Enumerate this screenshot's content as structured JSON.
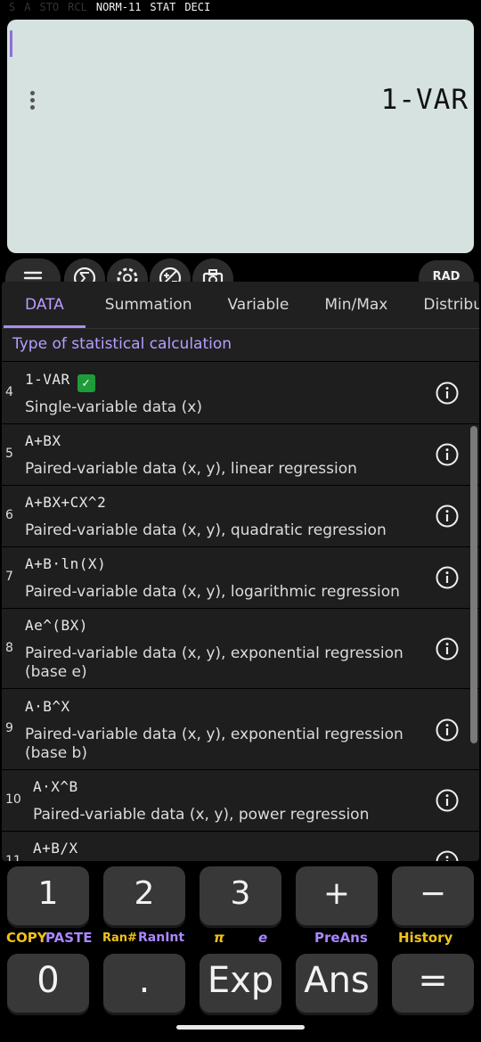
{
  "status_bar": {
    "indicators": [
      {
        "label": "S",
        "active": false
      },
      {
        "label": "A",
        "active": false
      },
      {
        "label": "STO",
        "active": false
      },
      {
        "label": "RCL",
        "active": false
      },
      {
        "label": "NORM-11",
        "active": true
      },
      {
        "label": "STAT",
        "active": true
      },
      {
        "label": "DECI",
        "active": true
      }
    ]
  },
  "display": {
    "text": "1-VAR",
    "background": "#d5e2df"
  },
  "toolbar": {
    "buttons": [
      {
        "icon": "menu-icon"
      },
      {
        "icon": "sigma-icon"
      },
      {
        "icon": "gear-icon"
      },
      {
        "icon": "calculator-ops-icon"
      },
      {
        "icon": "camera-icon"
      }
    ],
    "mode_label": "RAD"
  },
  "tabs": [
    "DATA",
    "Summation",
    "Variable",
    "Min/Max",
    "Distribution"
  ],
  "active_tab": "DATA",
  "section_title": "Type of statistical calculation",
  "items": [
    {
      "num": "4",
      "formula": "1-VAR",
      "desc": "Single-variable data (x)",
      "selected": true
    },
    {
      "num": "5",
      "formula": "A+BX",
      "desc": "Paired-variable data (x, y), linear regression"
    },
    {
      "num": "6",
      "formula": "A+BX+CX^2",
      "desc": "Paired-variable data (x, y), quadratic regression"
    },
    {
      "num": "7",
      "formula": "A+B·ln(X)",
      "desc": "Paired-variable data (x, y), logarithmic regression"
    },
    {
      "num": "8",
      "formula": "Ae^(BX)",
      "desc": "Paired-variable data (x, y), exponential regression (base e)"
    },
    {
      "num": "9",
      "formula": "A·B^X",
      "desc": "Paired-variable data (x, y), exponential regression (base b)"
    },
    {
      "num": "10",
      "formula": "A·X^B",
      "desc": "Paired-variable data (x, y), power regression"
    },
    {
      "num": "11",
      "formula": "A+B/X",
      "desc": ""
    }
  ],
  "keypad": {
    "row1": [
      "1",
      "2",
      "3",
      "+",
      "−"
    ],
    "secondary": {
      "copy": "COPY",
      "paste": "PASTE",
      "ran": "Ran#",
      "ranint": "RanInt",
      "pi": "π",
      "e": "e",
      "preans": "PreAns",
      "history": "History"
    },
    "row2": [
      "0",
      ".",
      "Exp",
      "Ans",
      "="
    ]
  },
  "colors": {
    "accent": "#b79dff",
    "secondary_label": "#f0c21b",
    "key": "#383838"
  }
}
